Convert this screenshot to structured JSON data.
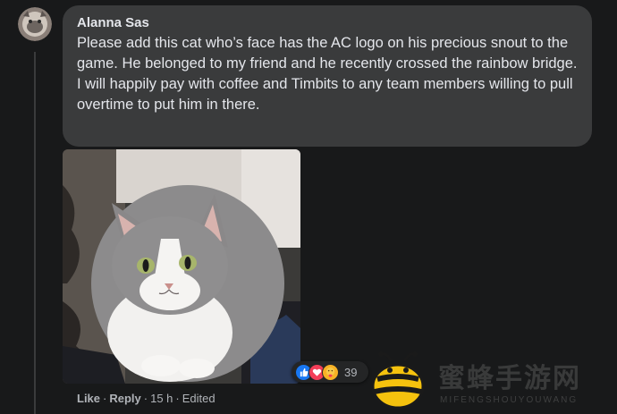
{
  "comment": {
    "author": "Alanna Sas",
    "text": "Please add this cat who’s face has the AC logo on his precious snout to the game. He belonged to my friend and he recently crossed the rainbow bridge. I will happily pay with coffee and Timbits to any team members willing to pull overtime to put him in there.",
    "reactions": {
      "icons": [
        "like-icon",
        "love-icon",
        "care-icon"
      ],
      "count": "39"
    },
    "actions": {
      "like": "Like",
      "reply": "Reply",
      "time": "15 h",
      "edited": "Edited",
      "separator": "·"
    }
  },
  "watermark": {
    "text": "蜜蜂手游网",
    "subtext": "MIFENGSHOUYOUWANG"
  },
  "colors": {
    "background": "#18191a",
    "bubble": "#3a3b3c",
    "text": "#e4e6eb",
    "secondary": "#b0b3b8",
    "like_blue": "#1877f2",
    "love_red": "#f33e58",
    "care_yellow": "#f7b125"
  }
}
